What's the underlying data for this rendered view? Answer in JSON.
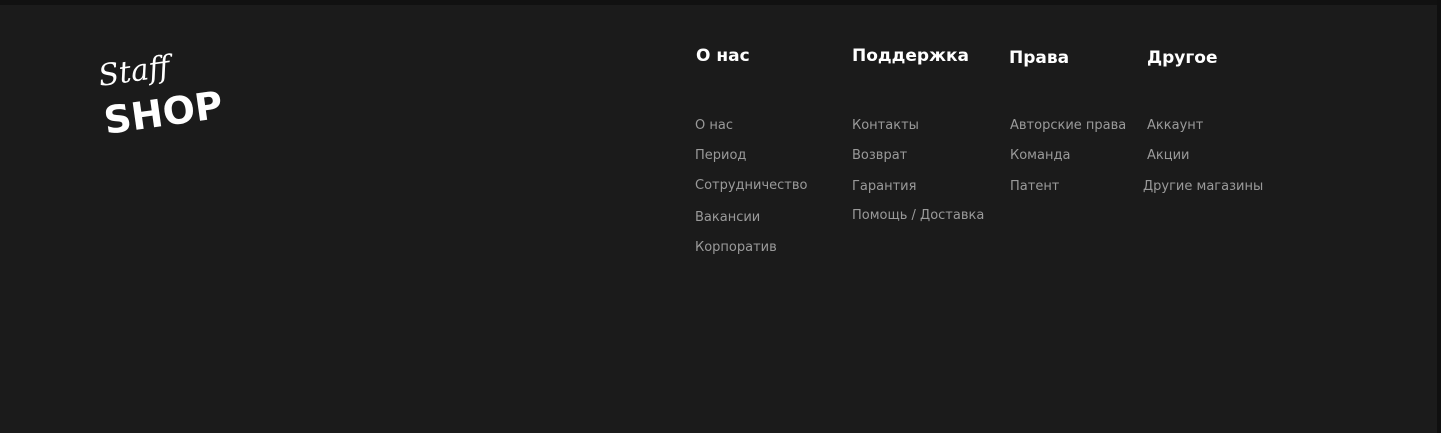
{
  "brand": {
    "logo_word_top": "Staff",
    "logo_word_bottom": "SHOP"
  },
  "footer": {
    "columns": [
      {
        "title": "О нас",
        "links": [
          "О нас",
          "Период",
          "Сотрудничество",
          "Вакансии",
          "Корпоратив"
        ]
      },
      {
        "title": "Поддержка",
        "links": [
          "Контакты",
          "Возврат",
          "Гарантия",
          "Помощь / Доставка"
        ]
      },
      {
        "title": "Права",
        "links": [
          "Авторские права",
          "Команда",
          "Патент"
        ]
      },
      {
        "title": "Другое",
        "links": [
          "Аккаунт",
          "Акции",
          "Другие магазины"
        ]
      }
    ]
  },
  "colors": {
    "background": "#1b1b1b",
    "heading": "#ffffff",
    "link": "#9a9a9a"
  }
}
